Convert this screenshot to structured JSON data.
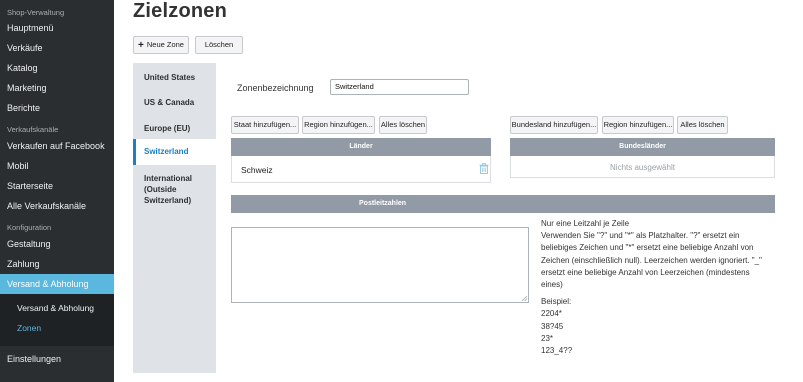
{
  "sidebar": {
    "sections": [
      {
        "heading": "Shop-Verwaltung",
        "items": [
          "Hauptmenü",
          "Verkäufe",
          "Katalog",
          "Marketing",
          "Berichte"
        ]
      },
      {
        "heading": "Verkaufskanäle",
        "items": [
          "Verkaufen auf Facebook",
          "Mobil",
          "Starterseite",
          "Alle Verkaufskanäle"
        ]
      },
      {
        "heading": "Konfiguration",
        "items": [
          "Gestaltung",
          "Zahlung",
          "Versand & Abholung"
        ]
      }
    ],
    "active_item": "Versand & Abholung",
    "subitems": [
      "Versand & Abholung",
      "Zonen"
    ],
    "current_subitem": "Zonen",
    "footer_item": "Einstellungen"
  },
  "page": {
    "title": "Zielzonen",
    "new_zone_label": "Neue Zone",
    "delete_label": "Löschen"
  },
  "zone_tabs": [
    {
      "label": "United States"
    },
    {
      "label": "US & Canada"
    },
    {
      "label": "Europe (EU)"
    },
    {
      "label": "Switzerland"
    },
    {
      "label": "International (Outside Switzerland)"
    }
  ],
  "active_zone_tab": "Switzerland",
  "zone": {
    "name_label": "Zonenbezeichnung",
    "name_value": "Switzerland"
  },
  "countries": {
    "add_state_label": "Staat hinzufügen...",
    "add_region_label": "Region hinzufügen...",
    "clear_all_label": "Alles löschen",
    "header": "Länder",
    "rows": [
      "Schweiz"
    ]
  },
  "states": {
    "add_state_label": "Bundesland hinzufügen...",
    "add_region_label": "Region hinzufügen...",
    "clear_all_label": "Alles löschen",
    "header": "Bundesländer",
    "empty_text": "Nichts ausgewählt"
  },
  "postcodes": {
    "header": "Postleitzahlen",
    "value": "",
    "help_line1": "Nur eine Leitzahl je Zeile",
    "help_body": "Verwenden Sie \"?\" und \"*\" als Platzhalter. \"?\" ersetzt ein beliebiges Zeichen und \"*\" ersetzt eine beliebige Anzahl von Zeichen (einschließlich null). Leerzeichen werden ignoriert. \"_\" ersetzt eine beliebige Anzahl von Leerzeichen (mindestens eines)",
    "example_heading": "Beispiel:",
    "examples": [
      "2204*",
      "38?45",
      "23*",
      "123_4??"
    ]
  },
  "colors": {
    "sidebar_bg": "#2b2e31",
    "sidebar_active": "#5ab7dd",
    "tab_active": "#1b7fc1",
    "panel_header": "#929ba5"
  }
}
